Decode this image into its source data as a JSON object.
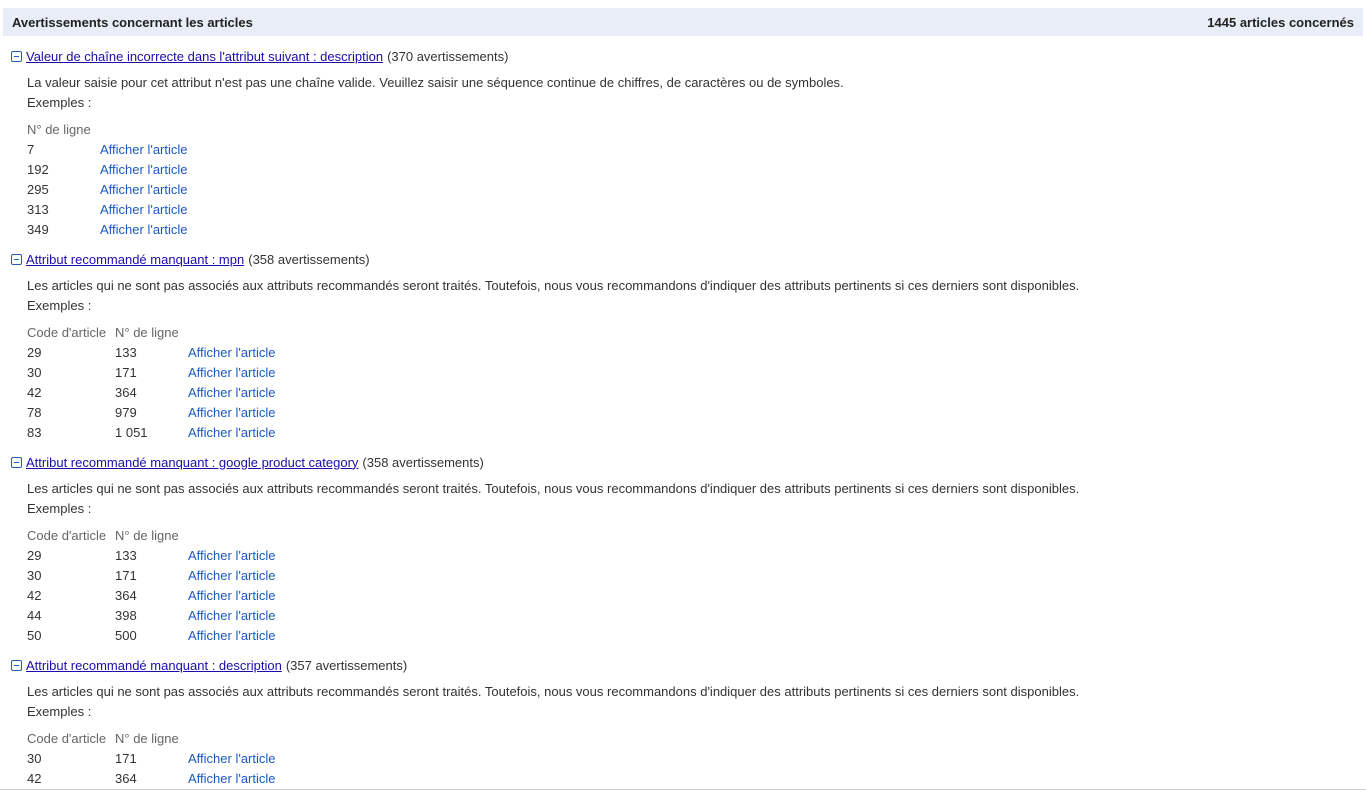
{
  "header": {
    "title": "Avertissements concernant les articles",
    "count": "1445 articles concernés"
  },
  "sections": [
    {
      "title": "Valeur de chaîne incorrecte dans l'attribut suivant : description",
      "count": "(370 avertissements)",
      "description": "La valeur saisie pour cet attribut n'est pas une chaîne valide. Veuillez saisir une séquence continue de chiffres, de caractères ou de symboles.",
      "examples_label": "Exemples :",
      "columns": [
        "N° de ligne"
      ],
      "rows": [
        {
          "line": "7",
          "link": "Afficher l'article"
        },
        {
          "line": "192",
          "link": "Afficher l'article"
        },
        {
          "line": "295",
          "link": "Afficher l'article"
        },
        {
          "line": "313",
          "link": "Afficher l'article"
        },
        {
          "line": "349",
          "link": "Afficher l'article"
        }
      ]
    },
    {
      "title": "Attribut recommandé manquant : mpn",
      "count": "(358 avertissements)",
      "description": "Les articles qui ne sont pas associés aux attributs recommandés seront traités. Toutefois, nous vous recommandons d'indiquer des attributs pertinents si ces derniers sont disponibles.",
      "examples_label": "Exemples :",
      "columns": [
        "Code d'article",
        "N° de ligne"
      ],
      "rows": [
        {
          "code": "29",
          "line": "133",
          "link": "Afficher l'article"
        },
        {
          "code": "30",
          "line": "171",
          "link": "Afficher l'article"
        },
        {
          "code": "42",
          "line": "364",
          "link": "Afficher l'article"
        },
        {
          "code": "78",
          "line": "979",
          "link": "Afficher l'article"
        },
        {
          "code": "83",
          "line": "1 051",
          "link": "Afficher l'article"
        }
      ]
    },
    {
      "title": "Attribut recommandé manquant : google product category",
      "count": "(358 avertissements)",
      "description": "Les articles qui ne sont pas associés aux attributs recommandés seront traités. Toutefois, nous vous recommandons d'indiquer des attributs pertinents si ces derniers sont disponibles.",
      "examples_label": "Exemples :",
      "columns": [
        "Code d'article",
        "N° de ligne"
      ],
      "rows": [
        {
          "code": "29",
          "line": "133",
          "link": "Afficher l'article"
        },
        {
          "code": "30",
          "line": "171",
          "link": "Afficher l'article"
        },
        {
          "code": "42",
          "line": "364",
          "link": "Afficher l'article"
        },
        {
          "code": "44",
          "line": "398",
          "link": "Afficher l'article"
        },
        {
          "code": "50",
          "line": "500",
          "link": "Afficher l'article"
        }
      ]
    },
    {
      "title": "Attribut recommandé manquant : description",
      "count": "(357 avertissements)",
      "description": "Les articles qui ne sont pas associés aux attributs recommandés seront traités. Toutefois, nous vous recommandons d'indiquer des attributs pertinents si ces derniers sont disponibles.",
      "examples_label": "Exemples :",
      "columns": [
        "Code d'article",
        "N° de ligne"
      ],
      "rows": [
        {
          "code": "30",
          "line": "171",
          "link": "Afficher l'article"
        },
        {
          "code": "42",
          "line": "364",
          "link": "Afficher l'article"
        }
      ]
    }
  ]
}
